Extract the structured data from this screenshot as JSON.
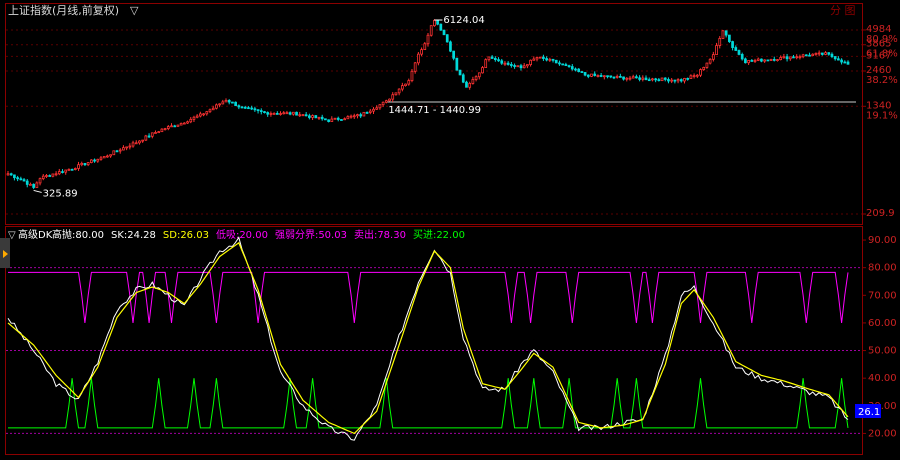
{
  "header": {
    "title": "上证指数(月线,前复权)",
    "title_arrow": "▽",
    "top_right": "分 图"
  },
  "indicator_header": {
    "arrow": "▽",
    "name": "高级DK",
    "items": [
      {
        "label": "高抛:",
        "value": "80.00",
        "color": "#ffffff"
      },
      {
        "label": "SK:",
        "value": "24.28",
        "color": "#ffffff"
      },
      {
        "label": "SD:",
        "value": "26.03",
        "color": "#ffff00"
      },
      {
        "label": "低吸:",
        "value": "20.00",
        "color": "#ff00ff"
      },
      {
        "label": "强弱分界:",
        "value": "50.03",
        "color": "#ff00ff"
      },
      {
        "label": "卖出:",
        "value": "78.30",
        "color": "#ff00ff"
      },
      {
        "label": "买进:",
        "value": "22.00",
        "color": "#00ff00"
      }
    ]
  },
  "chart_data": [
    {
      "type": "candlestick",
      "name": "price",
      "y_scale": "log",
      "y_ticks": [
        {
          "value": 4984,
          "label": "4984",
          "sub": "80.9%"
        },
        {
          "value": 3865,
          "label": "3865",
          "sub": "61.8%"
        },
        {
          "value": 3167,
          "label": "3167",
          "sub": ""
        },
        {
          "value": 2460,
          "label": "2460",
          "sub": "38.2%"
        },
        {
          "value": 1340,
          "label": "1340",
          "sub": "19.1%"
        },
        {
          "value": 209.9,
          "label": "209.9",
          "sub": ""
        }
      ],
      "annotations": [
        {
          "text": "6124.04",
          "type": "high"
        },
        {
          "text": "325.89",
          "type": "low"
        },
        {
          "text": "1444.71 - 1440.99",
          "type": "level",
          "value": 1442
        }
      ],
      "close_anchors": [
        [
          0,
          420
        ],
        [
          5,
          370
        ],
        [
          8,
          330
        ],
        [
          10,
          390
        ],
        [
          20,
          460
        ],
        [
          30,
          560
        ],
        [
          40,
          720
        ],
        [
          48,
          900
        ],
        [
          54,
          1000
        ],
        [
          60,
          1150
        ],
        [
          64,
          1300
        ],
        [
          68,
          1500
        ],
        [
          73,
          1300
        ],
        [
          80,
          1200
        ],
        [
          90,
          1180
        ],
        [
          100,
          1050
        ],
        [
          110,
          1150
        ],
        [
          118,
          1450
        ],
        [
          125,
          2100
        ],
        [
          130,
          4000
        ],
        [
          133,
          6000
        ],
        [
          136,
          4600
        ],
        [
          140,
          2500
        ],
        [
          143,
          1820
        ],
        [
          147,
          2400
        ],
        [
          150,
          3200
        ],
        [
          155,
          2800
        ],
        [
          160,
          2600
        ],
        [
          165,
          3100
        ],
        [
          170,
          2900
        ],
        [
          180,
          2300
        ],
        [
          190,
          2200
        ],
        [
          200,
          2150
        ],
        [
          210,
          2100
        ],
        [
          215,
          2300
        ],
        [
          220,
          3200
        ],
        [
          223,
          5000
        ],
        [
          226,
          3700
        ],
        [
          230,
          2900
        ],
        [
          240,
          3050
        ],
        [
          250,
          3250
        ],
        [
          255,
          3300
        ],
        [
          258,
          3100
        ],
        [
          262,
          2750
        ]
      ],
      "candle_count": 263
    },
    {
      "type": "line",
      "name": "高级DK",
      "y_ticks": [
        90,
        80,
        70,
        60,
        50,
        40,
        30,
        20
      ],
      "reference_lines": [
        {
          "name": "高抛",
          "value": 80
        },
        {
          "name": "强弱分界",
          "value": 50
        },
        {
          "name": "低吸",
          "value": 20
        }
      ],
      "current_value_label": "26.1",
      "series": [
        {
          "name": "SK",
          "color": "#ffffff",
          "anchors": [
            [
              0,
              62
            ],
            [
              8,
              50
            ],
            [
              15,
              38
            ],
            [
              22,
              32
            ],
            [
              28,
              46
            ],
            [
              34,
              65
            ],
            [
              40,
              72
            ],
            [
              45,
              74
            ],
            [
              50,
              70
            ],
            [
              55,
              66
            ],
            [
              60,
              76
            ],
            [
              66,
              86
            ],
            [
              72,
              90
            ],
            [
              78,
              70
            ],
            [
              85,
              42
            ],
            [
              92,
              30
            ],
            [
              100,
              22
            ],
            [
              108,
              18
            ],
            [
              115,
              30
            ],
            [
              122,
              55
            ],
            [
              128,
              75
            ],
            [
              133,
              87
            ],
            [
              138,
              78
            ],
            [
              142,
              55
            ],
            [
              148,
              36
            ],
            [
              155,
              36
            ],
            [
              160,
              45
            ],
            [
              164,
              50
            ],
            [
              170,
              42
            ],
            [
              178,
              22
            ],
            [
              185,
              22
            ],
            [
              192,
              24
            ],
            [
              198,
              25
            ],
            [
              205,
              48
            ],
            [
              210,
              70
            ],
            [
              214,
              73
            ],
            [
              220,
              60
            ],
            [
              227,
              44
            ],
            [
              235,
              40
            ],
            [
              242,
              38
            ],
            [
              250,
              35
            ],
            [
              256,
              33
            ],
            [
              262,
              25
            ]
          ]
        },
        {
          "name": "SD",
          "color": "#ffff00",
          "anchors": [
            [
              0,
              60
            ],
            [
              8,
              52
            ],
            [
              15,
              41
            ],
            [
              22,
              33
            ],
            [
              28,
              44
            ],
            [
              34,
              62
            ],
            [
              40,
              71
            ],
            [
              45,
              73
            ],
            [
              50,
              71
            ],
            [
              55,
              67
            ],
            [
              60,
              74
            ],
            [
              66,
              84
            ],
            [
              72,
              89
            ],
            [
              78,
              72
            ],
            [
              85,
              45
            ],
            [
              92,
              32
            ],
            [
              100,
              24
            ],
            [
              108,
              20
            ],
            [
              115,
              28
            ],
            [
              122,
              52
            ],
            [
              128,
              73
            ],
            [
              133,
              86
            ],
            [
              138,
              80
            ],
            [
              142,
              58
            ],
            [
              148,
              38
            ],
            [
              155,
              36
            ],
            [
              160,
              43
            ],
            [
              164,
              49
            ],
            [
              170,
              44
            ],
            [
              178,
              24
            ],
            [
              185,
              22
            ],
            [
              192,
              23
            ],
            [
              198,
              25
            ],
            [
              205,
              45
            ],
            [
              210,
              67
            ],
            [
              214,
              72
            ],
            [
              220,
              62
            ],
            [
              227,
              46
            ],
            [
              235,
              41
            ],
            [
              242,
              39
            ],
            [
              250,
              36
            ],
            [
              256,
              34
            ],
            [
              262,
              26
            ]
          ]
        },
        {
          "name": "卖出",
          "color": "#ff00ff",
          "base": 78.3,
          "dip_to": 60,
          "dips": [
            24,
            39,
            44,
            51,
            65,
            78,
            108,
            157,
            163,
            176,
            196,
            201,
            216,
            232,
            249,
            260
          ]
        },
        {
          "name": "买进",
          "color": "#00ff00",
          "base": 22,
          "spike_to": 40,
          "spikes": [
            20,
            26,
            47,
            58,
            65,
            88,
            95,
            118,
            156,
            164,
            175,
            190,
            196,
            216,
            248,
            260
          ]
        }
      ]
    }
  ]
}
